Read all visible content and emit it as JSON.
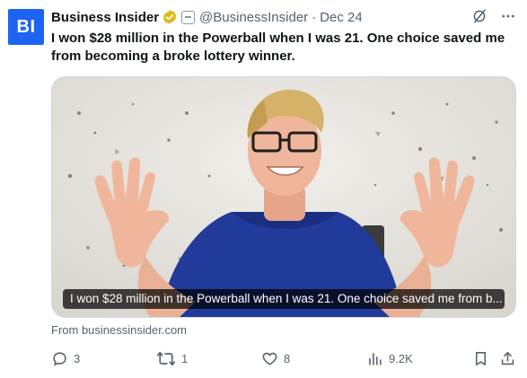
{
  "account": {
    "avatar_text": "BI",
    "name": "Business Insider",
    "handle": "@BusinessInsider",
    "separator": "·",
    "date": "Dec 24"
  },
  "tweet": {
    "text": "I won $28 million in the Powerball when I was 21. One choice saved me from becoming a broke lottery winner."
  },
  "media": {
    "caption": "I won $28 million in the Powerball when I was 21. One choice saved me from b..."
  },
  "source": "From businessinsider.com",
  "actions": {
    "replies": "3",
    "reposts": "1",
    "likes": "8",
    "views": "9.2K"
  },
  "colors": {
    "brand": "#1d64f2",
    "verified": "#e2b719",
    "muted": "#536471"
  },
  "icons": [
    "verified-badge-icon",
    "affiliate-badge-icon",
    "grok-icon",
    "more-icon",
    "reply-icon",
    "repost-icon",
    "like-icon",
    "views-icon",
    "bookmark-icon",
    "share-icon"
  ]
}
